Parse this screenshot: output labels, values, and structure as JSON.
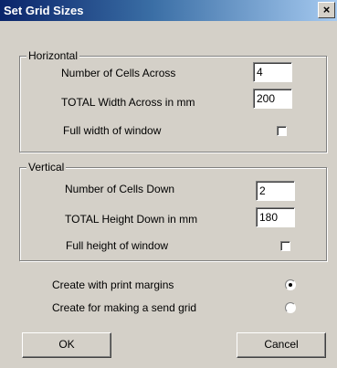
{
  "window": {
    "title": "Set Grid Sizes",
    "close_glyph": "×"
  },
  "horizontal": {
    "legend": "Horizontal",
    "cells_label": "Number of Cells Across",
    "cells_value": "4",
    "width_label": "TOTAL Width Across in mm",
    "width_value": "200",
    "full_label": "Full width of window",
    "full_checked": false
  },
  "vertical": {
    "legend": "Vertical",
    "cells_label": "Number of Cells Down",
    "cells_value": "2",
    "height_label": "TOTAL Height Down in mm",
    "height_value": "180",
    "full_label": "Full height of window",
    "full_checked": false
  },
  "options": {
    "print_margins_label": "Create with print margins",
    "print_margins_selected": true,
    "send_grid_label": "Create for making a send grid",
    "send_grid_selected": false
  },
  "buttons": {
    "ok": "OK",
    "cancel": "Cancel"
  }
}
